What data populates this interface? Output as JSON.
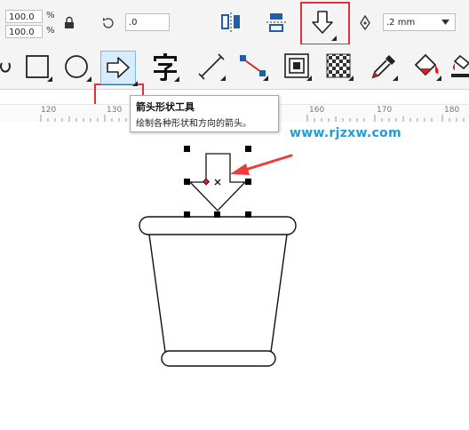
{
  "propbar": {
    "width_value": "100.0",
    "height_value": "100.0",
    "percent_symbol": "%",
    "rotation_value": ".0",
    "outline_width": ".2 mm"
  },
  "tooltip": {
    "title": "箭头形状工具",
    "description": "绘制各种形状和方向的箭头。"
  },
  "ruler": {
    "ticks": [
      "120",
      "130",
      "160",
      "170",
      "180"
    ]
  },
  "watermark": {
    "text": "www.rjzxw.com"
  },
  "colors": {
    "highlight_red": "#e0303a",
    "watermark_blue": "#1e9ed8",
    "selected_tool_bg": "#d7ecff"
  }
}
